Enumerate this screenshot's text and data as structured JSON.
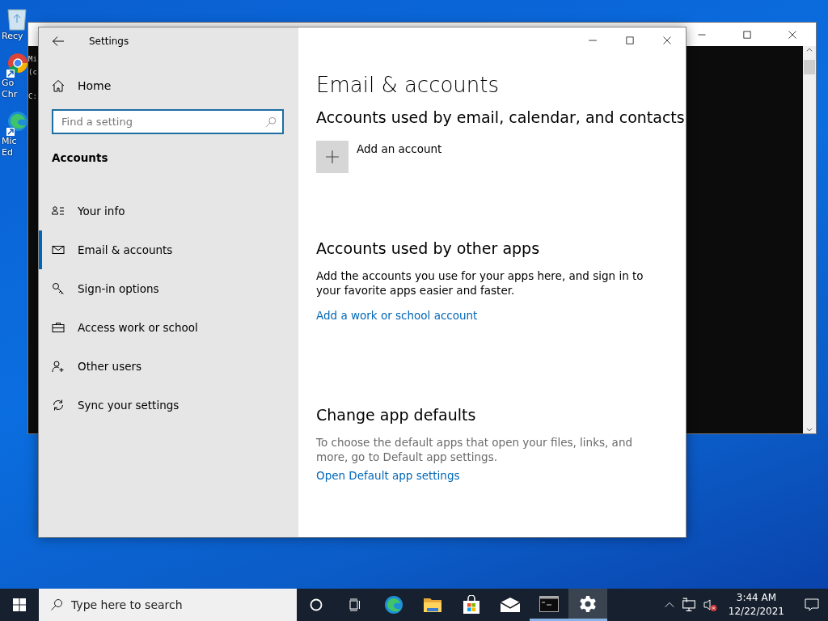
{
  "desktop": {
    "icons": [
      {
        "lines": [
          "Recy"
        ]
      },
      {
        "lines": [
          "Go",
          "Chr"
        ]
      },
      {
        "lines": [
          "Mic",
          "Ed"
        ]
      }
    ]
  },
  "console": {
    "lines": [
      "Mi",
      "(c",
      "C:"
    ]
  },
  "settings": {
    "title": "Settings",
    "home": "Home",
    "search": {
      "placeholder": "Find a setting"
    },
    "group": "Accounts",
    "nav": [
      {
        "label": "Your info",
        "selected": false
      },
      {
        "label": "Email & accounts",
        "selected": true
      },
      {
        "label": "Sign-in options",
        "selected": false
      },
      {
        "label": "Access work or school",
        "selected": false
      },
      {
        "label": "Other users",
        "selected": false
      },
      {
        "label": "Sync your settings",
        "selected": false
      }
    ],
    "heading": "Email & accounts",
    "sections": [
      {
        "kind": "add",
        "title": "Accounts used by email, calendar, and contacts",
        "action": "Add an account"
      },
      {
        "kind": "text",
        "title": "Accounts used by other apps",
        "body": "Add the accounts you use for your apps here, and sign in to your favorite apps easier and faster.",
        "link": "Add a work or school account",
        "muted": false
      },
      {
        "kind": "text",
        "title": "Change app defaults",
        "body": "To choose the default apps that open your files, links, and more, go to Default app settings.",
        "link": "Open Default app settings",
        "muted": true
      }
    ]
  },
  "taskbar": {
    "search": {
      "placeholder": "Type here to search"
    },
    "apps": [
      {
        "running": false,
        "selected": false
      },
      {
        "running": false,
        "selected": false
      },
      {
        "running": false,
        "selected": false
      },
      {
        "running": false,
        "selected": false
      },
      {
        "running": true,
        "selected": false
      },
      {
        "running": true,
        "selected": true
      }
    ],
    "time": "3:44 AM",
    "date": "12/22/2021"
  }
}
